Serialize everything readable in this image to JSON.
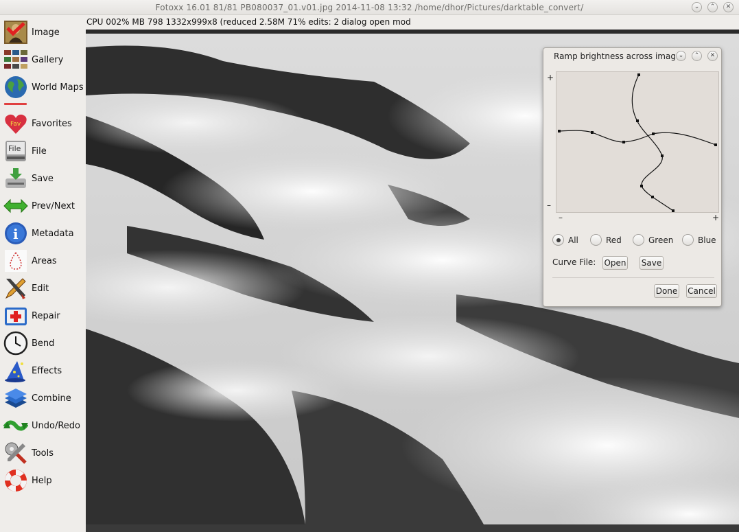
{
  "window": {
    "title": "Fotoxx 16.01  81/81  PB080037_01.v01.jpg  2014-11-08 13:32  /home/dhor/Pictures/darktable_convert/",
    "controls": {
      "minimize": "⌄",
      "maximize": "⌃",
      "close": "✕"
    }
  },
  "status": {
    "text": "CPU 002%  MB 798  1332x999x8 (reduced  2.58M  71%  edits: 2  dialog open  mod"
  },
  "sidebar": {
    "items": [
      {
        "label": "Image",
        "icon": "mona-lisa-icon"
      },
      {
        "label": "Gallery",
        "icon": "gallery-grid-icon"
      },
      {
        "label": "World Maps",
        "icon": "globe-icon"
      },
      {
        "label": "Favorites",
        "icon": "heart-fav-icon"
      },
      {
        "label": "File",
        "icon": "file-drive-icon"
      },
      {
        "label": "Save",
        "icon": "save-drive-icon"
      },
      {
        "label": "Prev/Next",
        "icon": "double-arrow-icon"
      },
      {
        "label": "Metadata",
        "icon": "info-icon"
      },
      {
        "label": "Areas",
        "icon": "lasso-icon"
      },
      {
        "label": "Edit",
        "icon": "pencil-brush-icon"
      },
      {
        "label": "Repair",
        "icon": "first-aid-icon"
      },
      {
        "label": "Bend",
        "icon": "clock-icon"
      },
      {
        "label": "Effects",
        "icon": "wizard-hat-icon"
      },
      {
        "label": "Combine",
        "icon": "layers-icon"
      },
      {
        "label": "Undo/Redo",
        "icon": "undo-redo-icon"
      },
      {
        "label": "Tools",
        "icon": "tools-icon"
      },
      {
        "label": "Help",
        "icon": "lifebuoy-icon"
      }
    ]
  },
  "dialog": {
    "title": "Ramp brightness across image",
    "controls": {
      "minimize": "⌄",
      "maximize": "⌃",
      "close": "✕"
    },
    "axis": {
      "plus_left": "+",
      "minus_left": "–",
      "minus_bottom": "–",
      "plus_bottom": "+"
    },
    "radios": [
      {
        "label": "All",
        "checked": true
      },
      {
        "label": "Red",
        "checked": false
      },
      {
        "label": "Green",
        "checked": false
      },
      {
        "label": "Blue",
        "checked": false
      }
    ],
    "curve_file_label": "Curve File:",
    "open_label": "Open",
    "save_label": "Save",
    "done_label": "Done",
    "cancel_label": "Cancel"
  },
  "colors": {
    "sidebar_bg": "#efedea",
    "dialog_bg": "#ece9e5",
    "curve_bg": "#e2ddd8",
    "image_dark": "#2a2a2a"
  }
}
